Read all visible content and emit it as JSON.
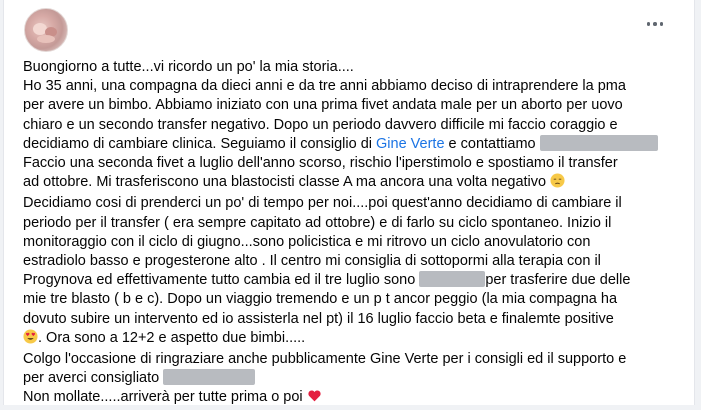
{
  "post": {
    "lines": [
      "Buongiorno a tutte...vi ricordo un po' la mia storia....",
      "Ho 35 anni, una compagna da dieci anni e da tre anni abbiamo deciso di intraprendere la pma",
      "per avere un bimbo. Abbiamo iniziato con una prima fivet andata male per un aborto per uovo",
      "chiaro e un secondo transfer negativo. Dopo un periodo davvero difficile mi faccio coraggio e",
      "decidiamo di cambiare clinica. Seguiamo il consiglio di ",
      "Gine Verte",
      " e contattiamo ",
      "Faccio una seconda fivet a luglio dell'anno scorso, rischio l'iperstimolo e spostiamo il transfer",
      "ad ottobre. Mi trasferiscono una blastocisti classe A ma ancora una volta negativo ",
      "Decidiamo cosi di prenderci un po' di tempo per noi....poi quest'anno decidiamo di cambiare il",
      "periodo per il transfer ( era sempre capitato ad ottobre) e di farlo su ciclo spontaneo. Inizio il",
      "monitoraggio con il ciclo di giugno...sono policistica e mi ritrovo un ciclo anovulatorio con",
      "estradiolo basso e progesterone alto . Il centro mi consiglia di sottopormi alla terapia con il",
      "Progynova ed effettivamente tutto cambia ed il tre luglio sono ",
      "per trasferire due delle",
      "mie tre blasto ( b e c). Dopo un viaggio tremendo e un p t ancor peggio (la mia compagna ha",
      "dovuto subire un intervento ed io assisterla nel pt) il 16  luglio faccio beta e finalemte positive",
      ". Ora sono a 12+2 e aspetto due bimbi.....",
      "Colgo l'occasione di ringraziare anche pubblicamente Gine Verte per i consigli ed il supporto e",
      "per averci consigliato ",
      "Non mollate.....arriverà per tutte  prima o poi "
    ]
  },
  "icons": [
    "avatar",
    "more-icon",
    "sad-face-emoji",
    "heart-eyes-emoji",
    "red-heart-emoji"
  ],
  "colors": {
    "mention": "#1b74e4",
    "redaction": "#b8bbc0",
    "heart": "#e41e3f"
  }
}
